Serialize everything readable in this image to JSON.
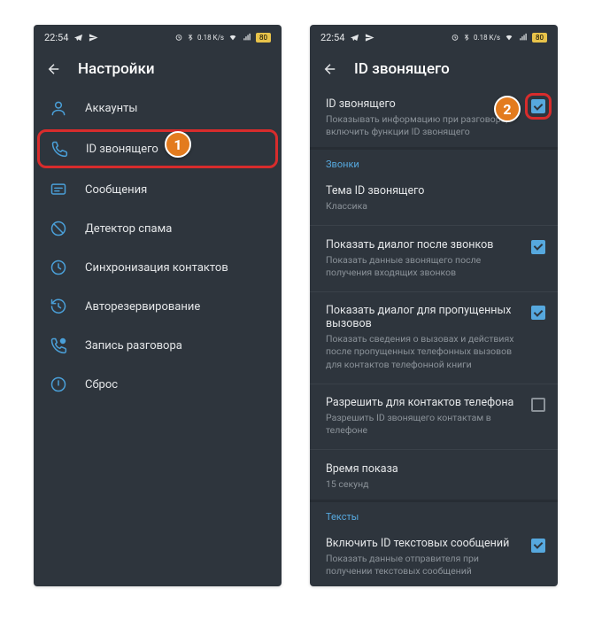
{
  "status": {
    "time": "22:54",
    "battery_pct": "80",
    "net_speed": "0.18 K/s"
  },
  "colors": {
    "accent": "#56a8de",
    "highlight_border": "#d82c2c",
    "badge": "#e37b1e"
  },
  "screen1": {
    "title": "Настройки",
    "items": [
      {
        "key": "accounts",
        "label": "Аккаунты",
        "icon": "user-icon"
      },
      {
        "key": "caller-id",
        "label": "ID звонящего",
        "icon": "phone-icon",
        "highlighted": true
      },
      {
        "key": "messages",
        "label": "Сообщения",
        "icon": "message-icon"
      },
      {
        "key": "spam",
        "label": "Детектор спама",
        "icon": "block-icon"
      },
      {
        "key": "sync",
        "label": "Синхронизация контактов",
        "icon": "sync-icon"
      },
      {
        "key": "backup",
        "label": "Авторезервирование",
        "icon": "history-icon"
      },
      {
        "key": "record",
        "label": "Запись разговора",
        "icon": "call-record-icon"
      },
      {
        "key": "reset",
        "label": "Сброс",
        "icon": "power-icon"
      }
    ],
    "badge": "1"
  },
  "screen2": {
    "title": "ID звонящего",
    "badge": "2",
    "header_row": {
      "title": "ID звонящего",
      "sub": "Показывать информацию при разговоре, включить функции ID звонящего",
      "checked": true,
      "highlighted": true
    },
    "sections": [
      {
        "header": "Звонки",
        "rows": [
          {
            "title": "Тема ID звонящего",
            "sub": "Классика"
          },
          {
            "title": "Показать диалог после звонков",
            "sub": "Показать данные звонящего после получения входящих звонков",
            "checked": true
          },
          {
            "title": "Показать диалог для пропущенных вызовов",
            "sub": "Показать сведения о вызовах и действиях после пропущенных телефонных вызовов для контактов телефонной книги",
            "checked": true
          },
          {
            "title": "Разрешить для контактов телефона",
            "sub": "Разрешить ID звонящего контактам в телефоне",
            "checked": false
          },
          {
            "title": "Время показа",
            "sub": "15 секунд"
          }
        ]
      },
      {
        "header": "Тексты",
        "rows": [
          {
            "title": "Включить ID текстовых сообщений",
            "sub": "Показать данные отправителя при получении текстовых сообщений",
            "checked": true
          }
        ]
      }
    ]
  }
}
